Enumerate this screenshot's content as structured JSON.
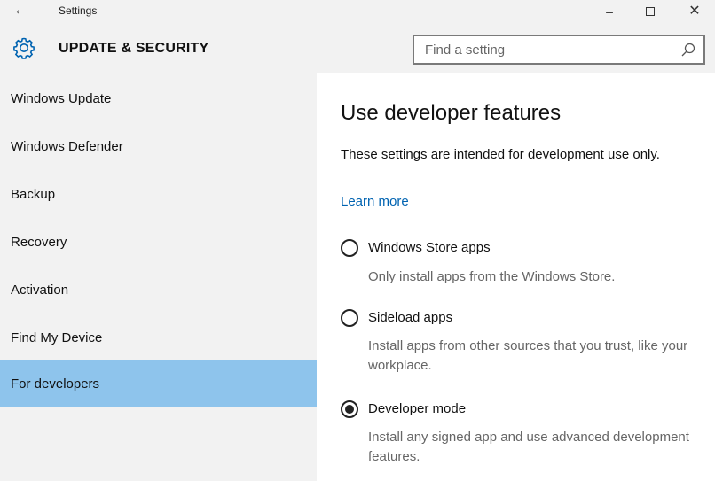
{
  "window": {
    "title": "Settings",
    "back_glyph": "←",
    "minimize_glyph": "–",
    "close_glyph": "✕"
  },
  "header": {
    "section_title": "UPDATE & SECURITY",
    "section_icon": "gear-icon",
    "search_placeholder": "Find a setting",
    "search_value": ""
  },
  "sidebar": {
    "items": [
      {
        "label": "Windows Update",
        "selected": false
      },
      {
        "label": "Windows Defender",
        "selected": false
      },
      {
        "label": "Backup",
        "selected": false
      },
      {
        "label": "Recovery",
        "selected": false
      },
      {
        "label": "Activation",
        "selected": false
      },
      {
        "label": "Find My Device",
        "selected": false
      },
      {
        "label": "For developers",
        "selected": true
      }
    ]
  },
  "main": {
    "title": "Use developer features",
    "intro": "These settings are intended for development use only.",
    "learn_more": "Learn more",
    "options": [
      {
        "label": "Windows Store apps",
        "description": "Only install apps from the Windows Store.",
        "checked": false
      },
      {
        "label": "Sideload apps",
        "description": "Install apps from other sources that you trust, like your workplace.",
        "checked": false
      },
      {
        "label": "Developer mode",
        "description": "Install any signed app and use advanced development features.",
        "checked": true
      }
    ]
  },
  "colors": {
    "chrome_bg": "#f2f2f2",
    "selected_bg": "#8ec4ec",
    "link": "#0063b1",
    "accent": "#0063b1"
  }
}
